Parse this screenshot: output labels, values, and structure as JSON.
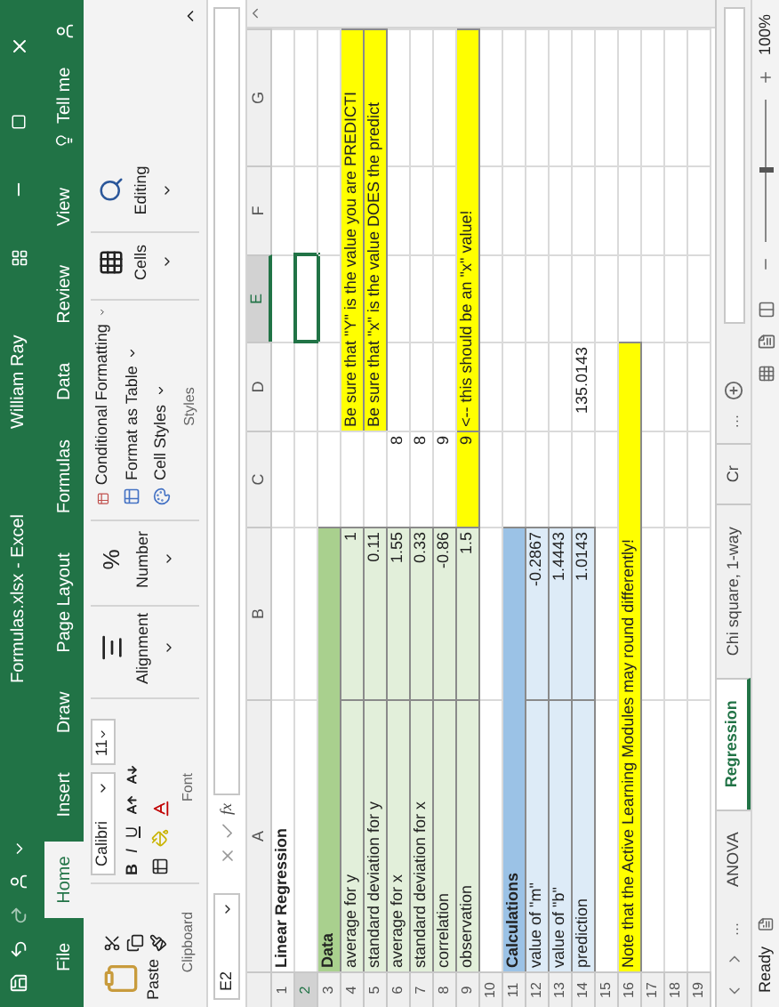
{
  "title_bar": {
    "title": "Formulas.xlsx - Excel",
    "user": "William Ray"
  },
  "menu_tabs": [
    {
      "label": "File",
      "selected": false
    },
    {
      "label": "Home",
      "selected": true
    },
    {
      "label": "Insert",
      "selected": false
    },
    {
      "label": "Draw",
      "selected": false
    },
    {
      "label": "Page Layout",
      "selected": false
    },
    {
      "label": "Formulas",
      "selected": false
    },
    {
      "label": "Data",
      "selected": false
    },
    {
      "label": "Review",
      "selected": false
    },
    {
      "label": "View",
      "selected": false
    }
  ],
  "tell_me": "Tell me",
  "ribbon": {
    "paste": "Paste",
    "clipboard_label": "Clipboard",
    "font_name": "Calibri",
    "font_size": "11",
    "bold": "B",
    "italic": "I",
    "underline": "U",
    "font_label": "Font",
    "alignment": "Alignment",
    "number": "Number",
    "percent": "%",
    "conditional_formatting": "Conditional Formatting",
    "format_as_table": "Format as Table",
    "cell_styles": "Cell Styles",
    "styles_label": "Styles",
    "cells": "Cells",
    "editing": "Editing"
  },
  "formula_bar": {
    "name_box": "E2",
    "fx": "fx"
  },
  "columns": [
    {
      "label": "A",
      "selected": false
    },
    {
      "label": "B",
      "selected": false
    },
    {
      "label": "C",
      "selected": false
    },
    {
      "label": "D",
      "selected": false
    },
    {
      "label": "E",
      "selected": true
    },
    {
      "label": "F",
      "selected": false
    },
    {
      "label": "G",
      "selected": false
    }
  ],
  "rows": [
    {
      "number": "1",
      "cells": [
        {
          "text": "Linear Regression",
          "bold": true
        }
      ]
    },
    {
      "number": "2",
      "cells": [
        {},
        {},
        {},
        {},
        {
          "selected": true
        }
      ]
    },
    {
      "number": "3",
      "cells": [
        {
          "text": "Data",
          "bold": true,
          "color": "#a9d08e"
        },
        {
          "color": "#a9d08e"
        }
      ]
    },
    {
      "number": "4",
      "cells": [
        {
          "text": "average for y",
          "color": "#e2efda"
        },
        {
          "text": "1",
          "kind": "number",
          "color": "#e2efda"
        },
        {},
        {
          "text": "Be sure that \"Y\" is the value you are PREDICTI",
          "color": "#ffff00"
        },
        {
          "color": "#ffff00"
        },
        {
          "color": "#ffff00"
        },
        {
          "color": "#ffff00"
        }
      ]
    },
    {
      "number": "5",
      "cells": [
        {
          "text": "standard deviation for y",
          "color": "#e2efda"
        },
        {
          "text": "0.11",
          "kind": "number",
          "color": "#e2efda"
        },
        {},
        {
          "text": "Be sure that \"x\" is the value DOES the predict",
          "color": "#ffff00"
        },
        {
          "color": "#ffff00"
        },
        {
          "color": "#ffff00"
        },
        {
          "color": "#ffff00"
        }
      ]
    },
    {
      "number": "6",
      "cells": [
        {
          "text": "average for x",
          "color": "#e2efda"
        },
        {
          "text": "1.55",
          "kind": "number",
          "color": "#e2efda"
        },
        {
          "text": "8",
          "kind": "number"
        }
      ]
    },
    {
      "number": "7",
      "cells": [
        {
          "text": "standard deviation for x",
          "color": "#e2efda"
        },
        {
          "text": "0.33",
          "kind": "number",
          "color": "#e2efda"
        },
        {
          "text": "8",
          "kind": "number"
        }
      ]
    },
    {
      "number": "8",
      "cells": [
        {
          "text": "correlation",
          "color": "#e2efda"
        },
        {
          "text": "-0.86",
          "kind": "number",
          "color": "#e2efda"
        },
        {
          "text": "9",
          "kind": "number"
        }
      ]
    },
    {
      "number": "9",
      "cells": [
        {
          "text": "observation",
          "color": "#e2efda"
        },
        {
          "text": "1.5",
          "kind": "number",
          "color": "#e2efda"
        },
        {
          "text": "9",
          "kind": "number",
          "color": "#ffff00"
        },
        {
          "text": "<-- this should be an \"x\" value!",
          "color": "#ffff00"
        },
        {
          "color": "#ffff00"
        },
        {
          "color": "#ffff00"
        },
        {
          "color": "#ffff00"
        }
      ]
    },
    {
      "number": "10",
      "cells": []
    },
    {
      "number": "11",
      "cells": [
        {
          "text": "Calculations",
          "bold": true,
          "color": "#9bc2e6"
        },
        {
          "color": "#9bc2e6"
        }
      ]
    },
    {
      "number": "12",
      "cells": [
        {
          "text": "value of \"m\"",
          "color": "#ddebf7"
        },
        {
          "text": "-0.2867",
          "kind": "number",
          "color": "#ddebf7"
        }
      ]
    },
    {
      "number": "13",
      "cells": [
        {
          "text": "value of \"b\"",
          "color": "#ddebf7"
        },
        {
          "text": "1.4443",
          "kind": "number",
          "color": "#ddebf7"
        }
      ]
    },
    {
      "number": "14",
      "cells": [
        {
          "text": "prediction",
          "color": "#ddebf7"
        },
        {
          "text": "1.0143",
          "kind": "number",
          "color": "#ddebf7"
        },
        {},
        {
          "text": "135.0143",
          "kind": "number"
        }
      ]
    },
    {
      "number": "15",
      "cells": []
    },
    {
      "number": "16",
      "cells": [
        {
          "text": "Note that the Active Learning Modules may round differently!",
          "color": "#ffff00"
        },
        {
          "color": "#ffff00"
        },
        {
          "color": "#ffff00"
        },
        {
          "color": "#ffff00"
        }
      ]
    },
    {
      "number": "17",
      "cells": []
    },
    {
      "number": "18",
      "cells": []
    },
    {
      "number": "19",
      "cells": []
    }
  ],
  "sheet_tabs": {
    "more_left": "...",
    "tabs": [
      {
        "label": "ANOVA",
        "selected": false
      },
      {
        "label": "Regression",
        "selected": true
      },
      {
        "label": "Chi square, 1-way",
        "selected": false
      },
      {
        "label": "Cr",
        "selected": false
      }
    ],
    "more_right": "..."
  },
  "status_bar": {
    "text": "Ready",
    "zoom": "100%",
    "zoom_slider": {
      "level": 0.5
    }
  }
}
